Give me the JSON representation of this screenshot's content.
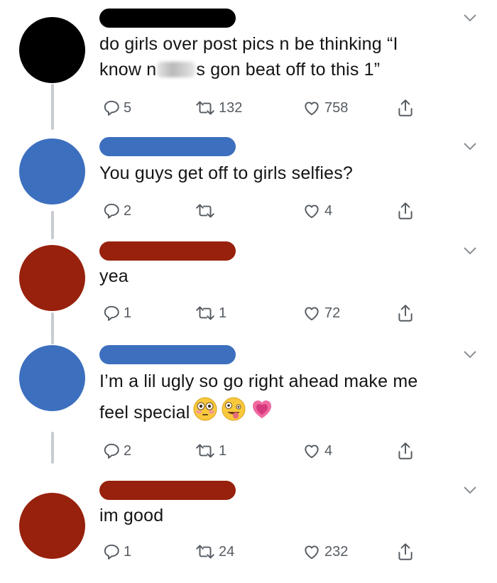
{
  "colors": {
    "black_avatar": "#000000",
    "blue_avatar": "#3d6fbf",
    "red_avatar": "#97210c",
    "icon_gray": "#555b61",
    "thread_line": "#c7ccd1"
  },
  "icons": {
    "reply": "reply-icon",
    "retweet": "retweet-icon",
    "like": "heart-icon",
    "share": "share-icon",
    "caret": "chevron-down-icon"
  },
  "tweets": [
    {
      "line1": "do girls over post pics n be thinking “I",
      "line2_pre": "know n",
      "line2_post": "s gon beat off to this 1”",
      "replies": "5",
      "retweets": "132",
      "likes": "758"
    },
    {
      "line1": "You guys get off to girls selfies?",
      "replies": "2",
      "retweets": "",
      "likes": "4"
    },
    {
      "line1": "yea",
      "replies": "1",
      "retweets": "1",
      "likes": "72"
    },
    {
      "line1": "I’m a lil ugly so go right ahead make me",
      "line2": "feel special",
      "emojis": [
        "flushed-face-emoji",
        "zany-face-emoji",
        "growing-heart-emoji"
      ],
      "replies": "2",
      "retweets": "1",
      "likes": "4"
    },
    {
      "line1": "im good",
      "replies": "1",
      "retweets": "24",
      "likes": "232"
    }
  ]
}
